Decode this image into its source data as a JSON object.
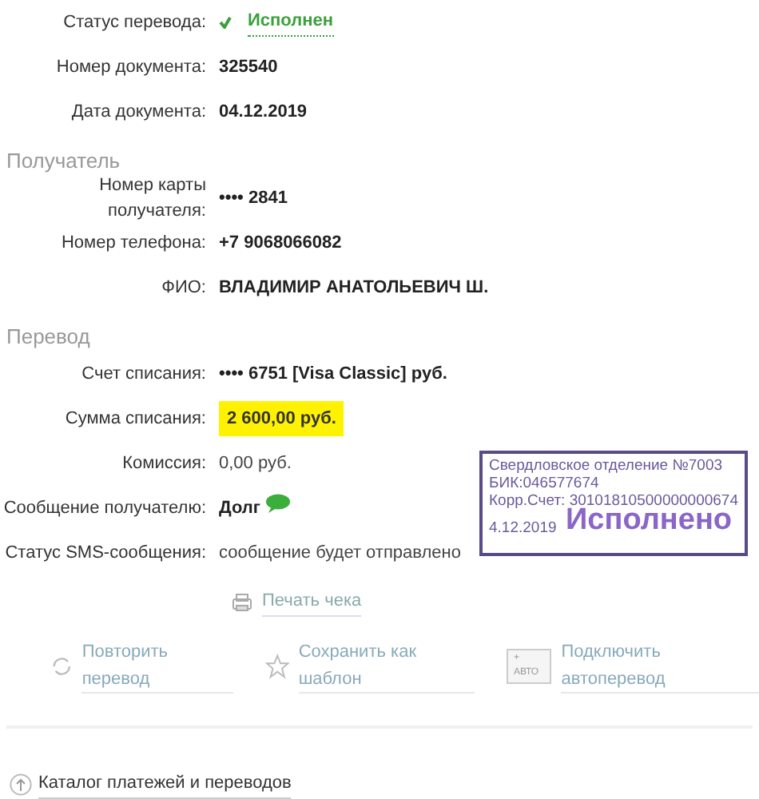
{
  "status_row": {
    "label": "Статус перевода:",
    "value": "Исполнен"
  },
  "document_rows": [
    {
      "label": "Номер документа:",
      "value": "325540"
    },
    {
      "label": "Дата документа:",
      "value": "04.12.2019"
    }
  ],
  "recipient": {
    "heading": "Получатель",
    "rows": [
      {
        "label": "Номер карты получателя:",
        "value": "•••• 2841",
        "kind": "bold"
      },
      {
        "label": "Номер телефона:",
        "value": "+7 9068066082",
        "kind": "bold"
      },
      {
        "label": "ФИО:",
        "value": "ВЛАДИМИР АНАТОЛЬЕВИЧ Ш.",
        "kind": "bold"
      }
    ]
  },
  "transfer": {
    "heading": "Перевод",
    "rows": [
      {
        "label": "Счет списания:",
        "value": "•••• 6751  [Visa Classic]  руб.",
        "kind": "bold"
      },
      {
        "label": "Сумма списания:",
        "value": "2 600,00  руб.",
        "kind": "highlight"
      },
      {
        "label": "Комиссия:",
        "value": "0,00 руб.",
        "kind": "plain"
      },
      {
        "label": "Сообщение получателю:",
        "value": "Долг",
        "kind": "sms"
      },
      {
        "label": "Статус SMS-сообщения:",
        "value": "сообщение будет отправлено",
        "kind": "plain"
      }
    ]
  },
  "stamp": {
    "lines": [
      "Свердловское отделение №7003",
      "БИК:046577674",
      "Корр.Счет: 30101810500000000674"
    ],
    "title": "Исполнено",
    "date": "4.12.2019"
  },
  "print_link": "Печать чека",
  "actions": [
    {
      "kind": "repeat",
      "label": "Повторить перевод"
    },
    {
      "kind": "template",
      "label": "Сохранить как шаблон"
    },
    {
      "kind": "auto",
      "badge": "+ АВТО",
      "label": "Подключить автоперевод"
    }
  ],
  "catalog_link": "Каталог платежей и переводов"
}
